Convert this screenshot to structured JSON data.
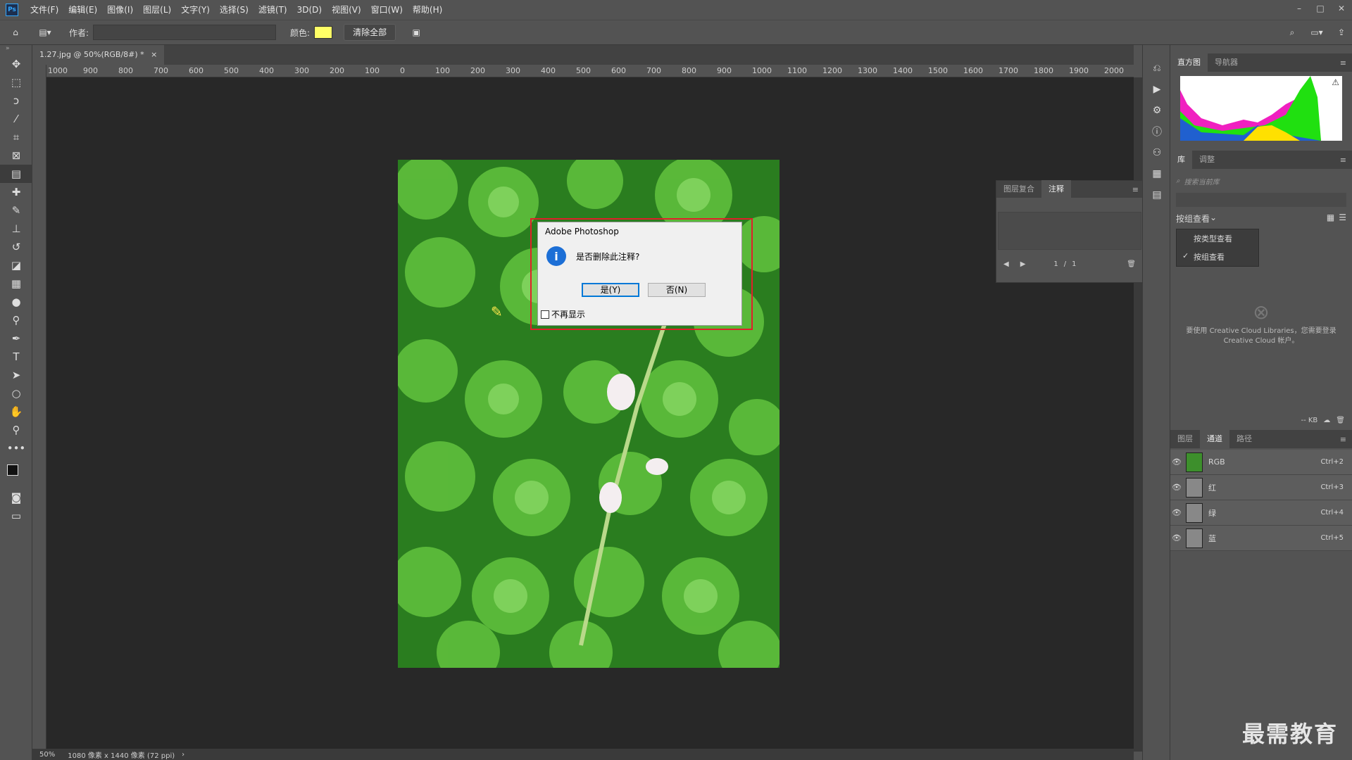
{
  "app": {
    "logo": "Ps"
  },
  "menu": [
    "文件(F)",
    "编辑(E)",
    "图像(I)",
    "图层(L)",
    "文字(Y)",
    "选择(S)",
    "滤镜(T)",
    "3D(D)",
    "视图(V)",
    "窗口(W)",
    "帮助(H)"
  ],
  "options": {
    "author_label": "作者:",
    "author_value": "",
    "color_label": "颜色:",
    "clear_all": "清除全部",
    "note_color": "#ffff66"
  },
  "document": {
    "tab_title": "1.27.jpg @ 50%(RGB/8#) *",
    "zoom": "50%",
    "size_info": "1080 像素 x 1440 像素 (72 ppi)"
  },
  "ruler": {
    "ticks": [
      "1000",
      "900",
      "800",
      "700",
      "600",
      "500",
      "400",
      "300",
      "200",
      "100",
      "0",
      "100",
      "200",
      "300",
      "400",
      "500",
      "600",
      "700",
      "800",
      "900",
      "1000",
      "1100",
      "1200",
      "1300",
      "1400",
      "1500",
      "1600",
      "1700",
      "1800",
      "1900",
      "2000"
    ]
  },
  "dialog": {
    "title": "Adobe Photoshop",
    "message": "是否删除此注释?",
    "yes": "是(Y)",
    "no": "否(N)",
    "dont_show": "不再显示"
  },
  "notes_panel": {
    "tabs": [
      "图层复合",
      "注释"
    ],
    "page": "1",
    "of": "1",
    "sep": "/"
  },
  "histogram_panel": {
    "tabs": [
      "直方图",
      "导航器"
    ]
  },
  "library_panel": {
    "tabs": [
      "库",
      "调整"
    ],
    "search_placeholder": "搜索当前库",
    "view_by": "按组查看",
    "view_options": [
      "按类型查看",
      "按组查看"
    ],
    "message": "要使用 Creative Cloud Libraries，您需要登录 Creative Cloud 帐户。",
    "size": "-- KB"
  },
  "channels_panel": {
    "tabs": [
      "图层",
      "通道",
      "路径"
    ],
    "channels": [
      {
        "name": "RGB",
        "shortcut": "Ctrl+2"
      },
      {
        "name": "红",
        "shortcut": "Ctrl+3"
      },
      {
        "name": "绿",
        "shortcut": "Ctrl+4"
      },
      {
        "name": "蓝",
        "shortcut": "Ctrl+5"
      }
    ]
  },
  "watermark": "最需教育"
}
